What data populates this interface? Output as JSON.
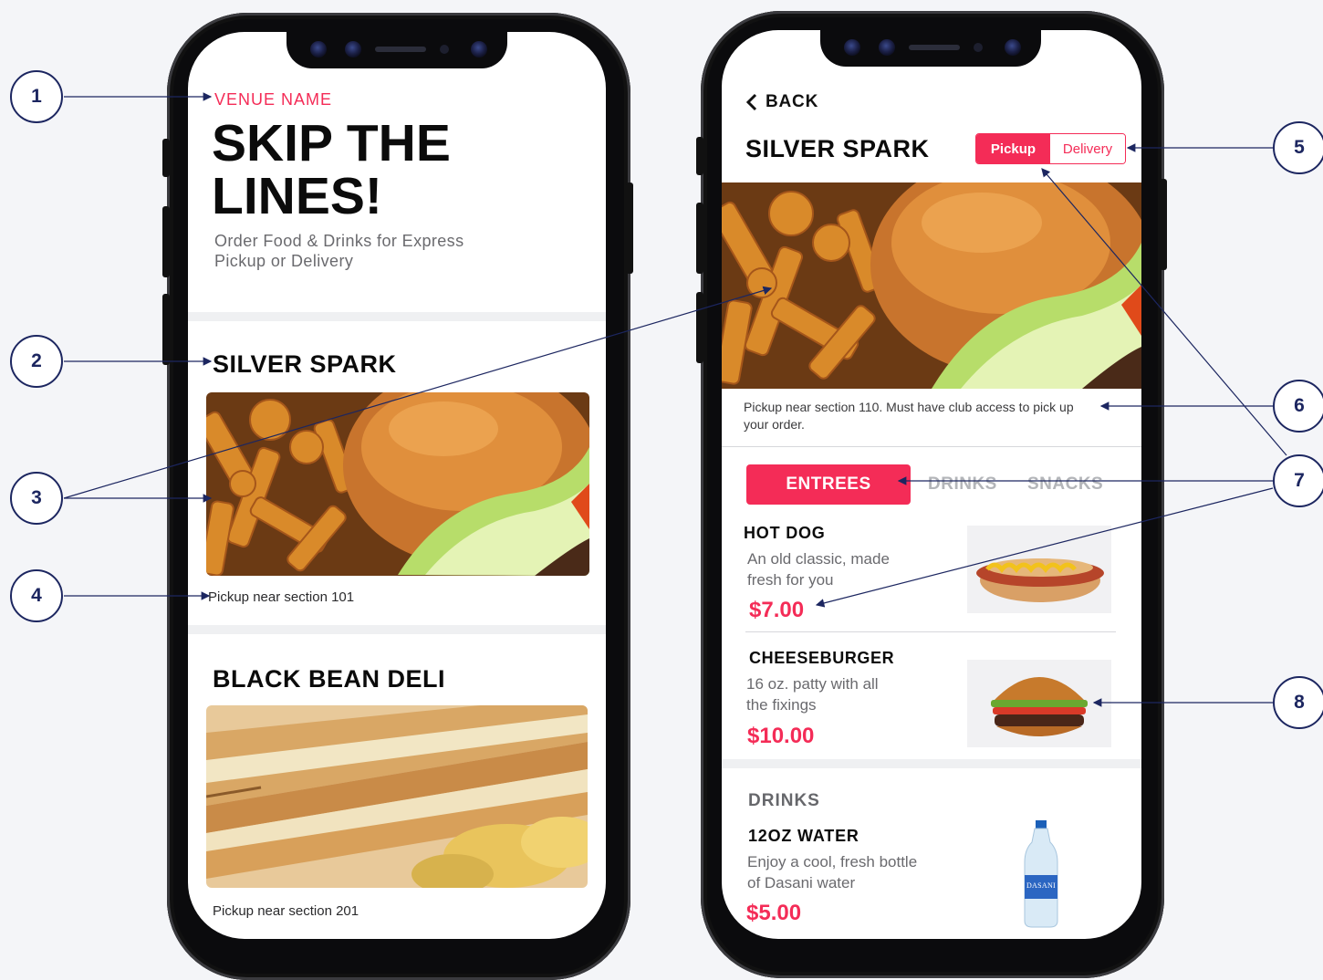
{
  "left_screen": {
    "venue_label": "VENUE NAME",
    "hero_title_line1": "SKIP THE",
    "hero_title_line2": "LINES!",
    "hero_subtitle_line1": "Order Food & Drinks for Express",
    "hero_subtitle_line2": "Pickup or Delivery",
    "venues": [
      {
        "name": "SILVER SPARK",
        "pickup": "Pickup near section 101"
      },
      {
        "name": "BLACK BEAN DELI",
        "pickup": "Pickup near section 201"
      }
    ]
  },
  "right_screen": {
    "back_label": "BACK",
    "venue_title": "SILVER SPARK",
    "mode_toggle": {
      "pickup": "Pickup",
      "delivery": "Delivery",
      "selected": "Pickup"
    },
    "pickup_note_line1": "Pickup near section 110. Must have club access to pick up",
    "pickup_note_line2": "your order.",
    "tabs": {
      "entrees": "ENTREES",
      "drinks": "DRINKS",
      "snacks": "SNACKS",
      "selected": "ENTREES"
    },
    "items": [
      {
        "name": "HOT DOG",
        "desc_line1": "An old classic, made",
        "desc_line2": "fresh for you",
        "price": "$7.00"
      },
      {
        "name": "CHEESEBURGER",
        "desc_line1": "16 oz. patty with all",
        "desc_line2": "the fixings",
        "price": "$10.00"
      }
    ],
    "drinks_section_title": "DRINKS",
    "drinks": [
      {
        "name": "12OZ WATER",
        "desc_line1": "Enjoy a cool, fresh bottle",
        "desc_line2": "of Dasani water",
        "price": "$5.00",
        "brand": "DASANI"
      }
    ]
  },
  "callouts": [
    "1",
    "2",
    "3",
    "4",
    "5",
    "6",
    "7",
    "8"
  ],
  "colors": {
    "accent": "#f42c57",
    "callout": "#1c2660",
    "background": "#f4f5f8"
  }
}
